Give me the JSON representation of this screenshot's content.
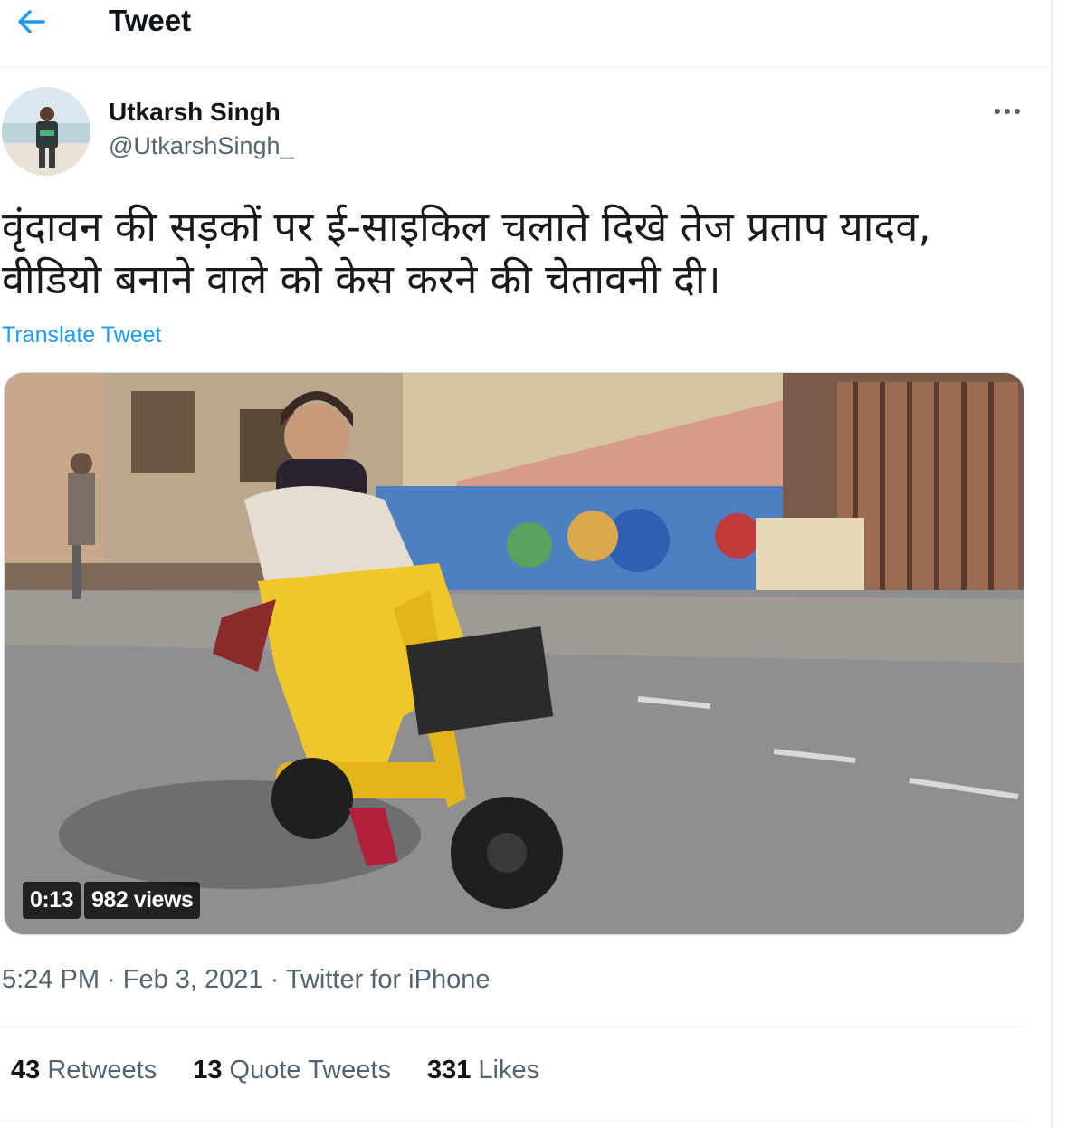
{
  "header": {
    "title": "Tweet",
    "back_icon": "arrow-left-icon"
  },
  "author": {
    "name": "Utkarsh Singh",
    "handle": "@UtkarshSingh_"
  },
  "more_icon": "ellipsis-icon",
  "tweet": {
    "text_lines": [
      "वृंदावन की सड़कों पर ई-साइकिल चलाते दिखे तेज प्रताप यादव,",
      "वीडियो बनाने वाले को केस करने की चेतावनी दी।"
    ],
    "translate_label": "Translate Tweet"
  },
  "video": {
    "duration": "0:13",
    "views": "982 views"
  },
  "meta": {
    "time": "5:24 PM",
    "separator": " · ",
    "date": "Feb 3, 2021",
    "source": "Twitter for iPhone"
  },
  "stats": [
    {
      "count": "43",
      "label": "Retweets"
    },
    {
      "count": "13",
      "label": "Quote Tweets"
    },
    {
      "count": "331",
      "label": "Likes"
    }
  ],
  "colors": {
    "accent": "#1d9bf0",
    "secondary_text": "#536471",
    "primary_text": "#0f1419"
  }
}
